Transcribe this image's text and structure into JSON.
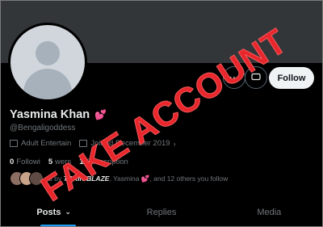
{
  "profile": {
    "name": "Yasmina Khan",
    "name_emoji": "💕",
    "handle": "@Bengaligoddess",
    "category": "Adult Entertain",
    "joined": "Joined December 2019",
    "following_count": "0",
    "following_label": "Followi",
    "followers_count": "5",
    "followers_label": "wers",
    "subscriptions_count": "1",
    "subscriptions_label": "Subscription"
  },
  "actions": {
    "more_icon": "more-icon",
    "message_icon": "message-icon",
    "follow_label": "Follow"
  },
  "followed_by": {
    "prefix": "d by",
    "name1": "TORIN BLAZE",
    "mid": ", Yasmina",
    "emoji": "💕",
    "suffix": ", and 12 others you follow"
  },
  "tabs": [
    {
      "label": "Posts",
      "active": true
    },
    {
      "label": "Replies",
      "active": false
    },
    {
      "label": "Media",
      "active": false
    }
  ],
  "overlay": {
    "stamp_text": "FAKE ACCOUNT",
    "stamp_color": "#e8262b"
  },
  "colors": {
    "background": "#000000",
    "banner": "#333639",
    "accent": "#1d9bf0",
    "muted": "#71767b"
  }
}
